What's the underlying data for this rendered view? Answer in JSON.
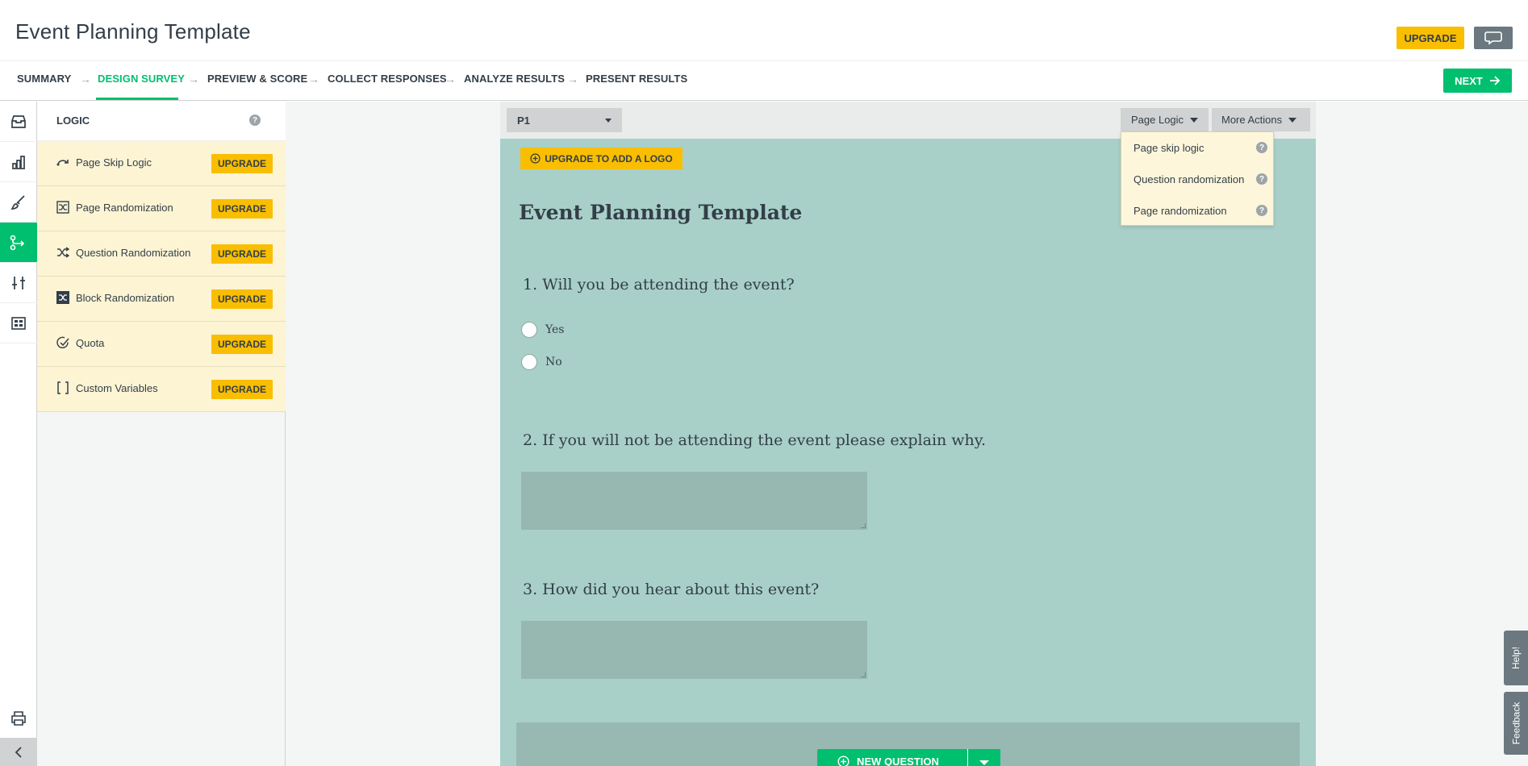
{
  "header": {
    "title": "Event Planning Template",
    "upgrade_label": "UPGRADE",
    "chat_icon": "speech-bubble-icon"
  },
  "steps": [
    {
      "label": "SUMMARY",
      "active": false
    },
    {
      "label": "DESIGN SURVEY",
      "active": true
    },
    {
      "label": "PREVIEW & SCORE",
      "active": false
    },
    {
      "label": "COLLECT RESPONSES",
      "active": false
    },
    {
      "label": "ANALYZE RESULTS",
      "active": false
    },
    {
      "label": "PRESENT RESULTS",
      "active": false
    }
  ],
  "next_label": "NEXT",
  "rail": [
    "question-bank-icon",
    "builder-chart-icon",
    "style-brush-icon",
    "logic-icon",
    "options-sliders-icon",
    "templates-grid-icon",
    "print-icon",
    "collapse-chevron-icon"
  ],
  "panel": {
    "title": "LOGIC",
    "items": [
      {
        "label": "Page Skip Logic",
        "icon": "skip-logic-icon",
        "action": "UPGRADE"
      },
      {
        "label": "Page Randomization",
        "icon": "page-random-icon",
        "action": "UPGRADE"
      },
      {
        "label": "Question Randomization",
        "icon": "shuffle-icon",
        "action": "UPGRADE"
      },
      {
        "label": "Block Randomization",
        "icon": "block-shuffle-icon",
        "action": "UPGRADE"
      },
      {
        "label": "Quota",
        "icon": "check-circle-icon",
        "action": "UPGRADE"
      },
      {
        "label": "Custom Variables",
        "icon": "brackets-icon",
        "action": "UPGRADE"
      }
    ]
  },
  "page_bar": {
    "page": "P1",
    "page_logic": "Page Logic",
    "more_actions": "More Actions"
  },
  "dropdown": [
    {
      "label": "Page skip logic"
    },
    {
      "label": "Question randomization"
    },
    {
      "label": "Page randomization"
    }
  ],
  "survey": {
    "logo_button": "UPGRADE TO ADD A LOGO",
    "title": "Event Planning Template",
    "questions": [
      {
        "title": "1. Will you be attending the event?",
        "options": [
          "Yes",
          "No"
        ]
      },
      {
        "title": "2. If you will not be attending the event please explain why."
      },
      {
        "title": "3. How did you hear about this event?"
      }
    ],
    "new_question": "NEW QUESTION"
  },
  "side_tabs": {
    "help": "Help!",
    "feedback": "Feedback"
  },
  "colors": {
    "accent": "#00bf6f",
    "upgrade": "#f9be00",
    "survey_bg": "#a8d0c8"
  }
}
